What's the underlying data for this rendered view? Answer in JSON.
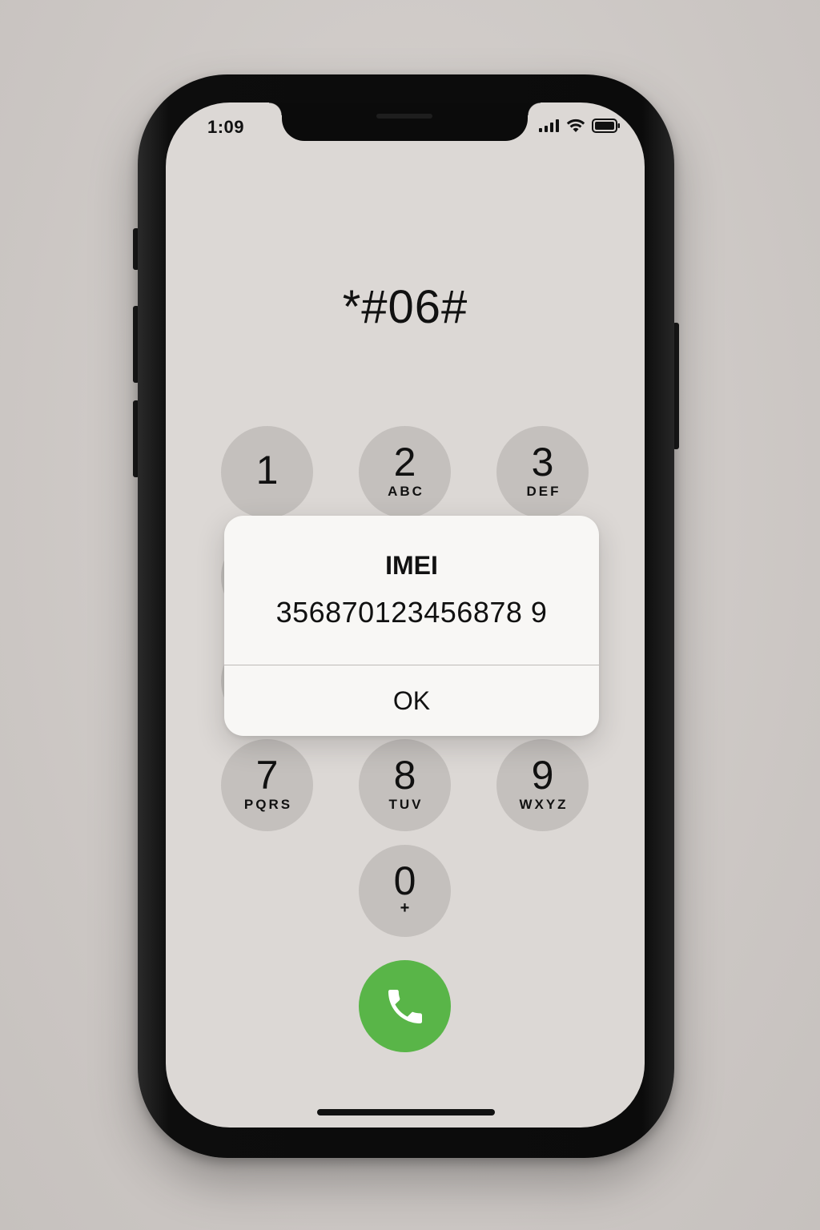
{
  "status_bar": {
    "time": "1:09",
    "icons": [
      "cellular-signal-icon",
      "wifi-icon",
      "battery-icon"
    ]
  },
  "dialer": {
    "dialed_number": "*#06#",
    "keys": [
      {
        "digit": "1",
        "letters": ""
      },
      {
        "digit": "2",
        "letters": "ABC"
      },
      {
        "digit": "3",
        "letters": "DEF"
      },
      {
        "digit": "7",
        "letters": "PQRS"
      },
      {
        "digit": "8",
        "letters": "TUV"
      },
      {
        "digit": "9",
        "letters": "WXYZ"
      },
      {
        "digit": "0",
        "letters": "+"
      }
    ],
    "call_icon": "phone-icon"
  },
  "alert": {
    "title": "IMEI",
    "message": "356870123456878 9",
    "button": "OK"
  },
  "colors": {
    "call_button": "#59b548",
    "key_background": "#c4c0bd",
    "screen_background": "#dcd8d5",
    "alert_background": "#f8f7f5"
  }
}
